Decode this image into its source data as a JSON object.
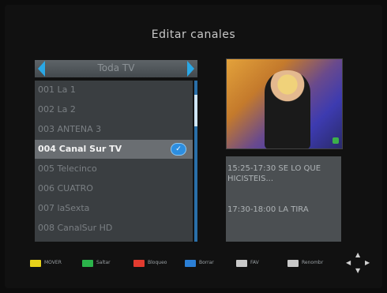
{
  "screen": {
    "title": "Editar canales"
  },
  "channel_list": {
    "header_label": "Toda TV",
    "rows": [
      {
        "label": "001 La 1",
        "selected": false
      },
      {
        "label": "002 La 2",
        "selected": false
      },
      {
        "label": "003 ANTENA 3",
        "selected": false
      },
      {
        "label": "004 Canal Sur TV",
        "selected": true
      },
      {
        "label": "005 Telecinco",
        "selected": false
      },
      {
        "label": "006 CUATRO",
        "selected": false
      },
      {
        "label": "007 laSexta",
        "selected": false
      },
      {
        "label": "008 CanalSur HD",
        "selected": false
      }
    ]
  },
  "epg": {
    "items": [
      {
        "text": "15:25-17:30  SE LO QUE HICISTEIS..."
      },
      {
        "text": "17:30-18:00  LA TIRA"
      }
    ]
  },
  "footer": {
    "keys": [
      {
        "color": "#e8d21a",
        "label": "MOVER"
      },
      {
        "color": "#2bb34a",
        "label": "Saltar"
      },
      {
        "color": "#e23b2f",
        "label": "Bloqueo"
      },
      {
        "color": "#2b7fd6",
        "label": "Borrar"
      },
      {
        "color": "#c9c9c9",
        "label": "FAV"
      },
      {
        "color": "#c9c9c9",
        "label": "Renombr"
      }
    ]
  },
  "colors": {
    "accent": "#2aa8e6",
    "selected_row": "#6a6e72"
  },
  "icons": {
    "selection_mark": "edit-mark-icon",
    "navigation": "navigation-cross-icon"
  }
}
